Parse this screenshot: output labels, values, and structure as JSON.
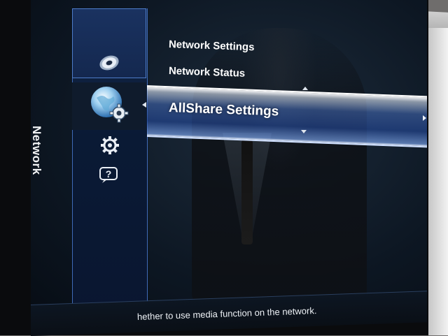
{
  "side_title": "Network",
  "menu": {
    "items": [
      {
        "label": "Network Settings"
      },
      {
        "label": "Network Status"
      },
      {
        "label": "AllShare Settings"
      }
    ],
    "selected_index": 2
  },
  "description": "hether to use media function on the network.",
  "icons": [
    "disc-icon",
    "globe-gear-icon",
    "gear-icon",
    "help-icon"
  ],
  "colors": {
    "highlight": "#3e6fc4",
    "panel": "#0a1a35",
    "panel_border": "#3f6ab7"
  }
}
